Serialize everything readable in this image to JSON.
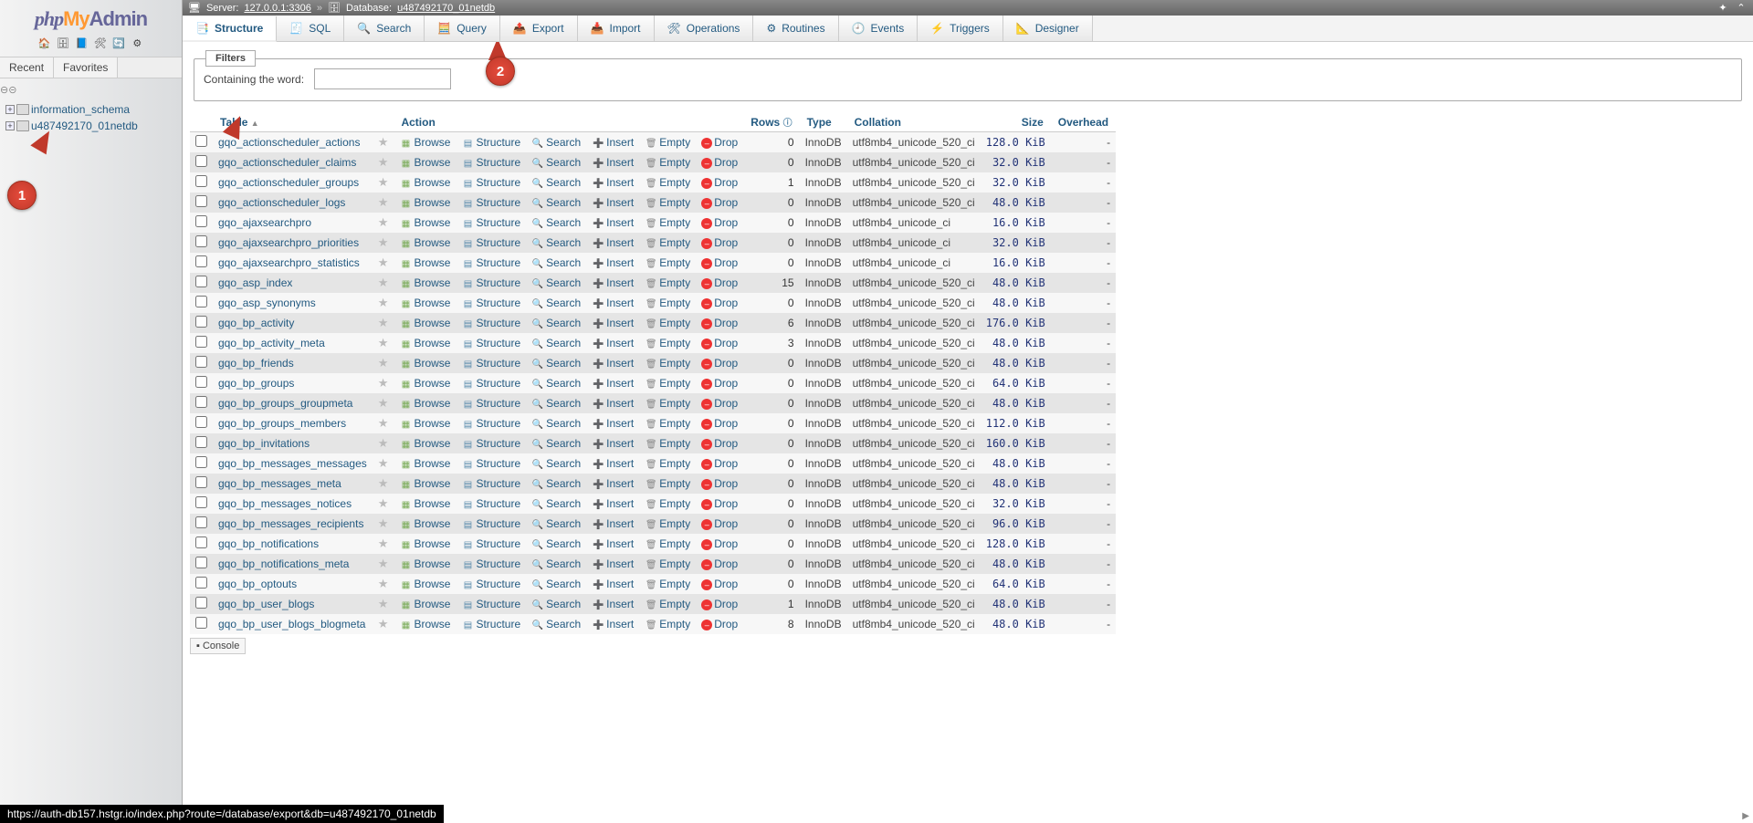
{
  "logo": {
    "p1": "php",
    "p2": "My",
    "p3": "Admin"
  },
  "side_icons": [
    "🏠",
    "🗄",
    "📘",
    "🛠",
    "🔄",
    "⚙"
  ],
  "tree_tabs": {
    "recent": "Recent",
    "favorites": "Favorites"
  },
  "tree_databases": [
    "information_schema",
    "u487492170_01netdb"
  ],
  "breadcrumb": {
    "server_label": "Server:",
    "server": "127.0.0.1:3306",
    "database_label": "Database:",
    "database": "u487492170_01netdb"
  },
  "tabs": [
    {
      "label": "Structure",
      "icon": "📑",
      "active": true
    },
    {
      "label": "SQL",
      "icon": "🧾",
      "active": false
    },
    {
      "label": "Search",
      "icon": "🔍",
      "active": false
    },
    {
      "label": "Query",
      "icon": "🧮",
      "active": false
    },
    {
      "label": "Export",
      "icon": "📤",
      "active": false
    },
    {
      "label": "Import",
      "icon": "📥",
      "active": false
    },
    {
      "label": "Operations",
      "icon": "🛠",
      "active": false
    },
    {
      "label": "Routines",
      "icon": "⚙",
      "active": false
    },
    {
      "label": "Events",
      "icon": "🕘",
      "active": false
    },
    {
      "label": "Triggers",
      "icon": "⚡",
      "active": false
    },
    {
      "label": "Designer",
      "icon": "📐",
      "active": false
    }
  ],
  "filters": {
    "legend": "Filters",
    "label": "Containing the word:",
    "value": ""
  },
  "columns": {
    "table": "Table",
    "action": "Action",
    "rows": "Rows",
    "type": "Type",
    "collation": "Collation",
    "size": "Size",
    "overhead": "Overhead"
  },
  "actions": {
    "browse": "Browse",
    "structure": "Structure",
    "search": "Search",
    "insert": "Insert",
    "empty": "Empty",
    "drop": "Drop"
  },
  "tables": [
    {
      "name": "gqo_actionscheduler_actions",
      "rows": 0,
      "type": "InnoDB",
      "collation": "utf8mb4_unicode_520_ci",
      "size": "128.0 KiB",
      "overhead": "-"
    },
    {
      "name": "gqo_actionscheduler_claims",
      "rows": 0,
      "type": "InnoDB",
      "collation": "utf8mb4_unicode_520_ci",
      "size": "32.0 KiB",
      "overhead": "-"
    },
    {
      "name": "gqo_actionscheduler_groups",
      "rows": 1,
      "type": "InnoDB",
      "collation": "utf8mb4_unicode_520_ci",
      "size": "32.0 KiB",
      "overhead": "-"
    },
    {
      "name": "gqo_actionscheduler_logs",
      "rows": 0,
      "type": "InnoDB",
      "collation": "utf8mb4_unicode_520_ci",
      "size": "48.0 KiB",
      "overhead": "-"
    },
    {
      "name": "gqo_ajaxsearchpro",
      "rows": 0,
      "type": "InnoDB",
      "collation": "utf8mb4_unicode_ci",
      "size": "16.0 KiB",
      "overhead": "-"
    },
    {
      "name": "gqo_ajaxsearchpro_priorities",
      "rows": 0,
      "type": "InnoDB",
      "collation": "utf8mb4_unicode_ci",
      "size": "32.0 KiB",
      "overhead": "-"
    },
    {
      "name": "gqo_ajaxsearchpro_statistics",
      "rows": 0,
      "type": "InnoDB",
      "collation": "utf8mb4_unicode_ci",
      "size": "16.0 KiB",
      "overhead": "-"
    },
    {
      "name": "gqo_asp_index",
      "rows": 15,
      "type": "InnoDB",
      "collation": "utf8mb4_unicode_520_ci",
      "size": "48.0 KiB",
      "overhead": "-"
    },
    {
      "name": "gqo_asp_synonyms",
      "rows": 0,
      "type": "InnoDB",
      "collation": "utf8mb4_unicode_520_ci",
      "size": "48.0 KiB",
      "overhead": "-"
    },
    {
      "name": "gqo_bp_activity",
      "rows": 6,
      "type": "InnoDB",
      "collation": "utf8mb4_unicode_520_ci",
      "size": "176.0 KiB",
      "overhead": "-"
    },
    {
      "name": "gqo_bp_activity_meta",
      "rows": 3,
      "type": "InnoDB",
      "collation": "utf8mb4_unicode_520_ci",
      "size": "48.0 KiB",
      "overhead": "-"
    },
    {
      "name": "gqo_bp_friends",
      "rows": 0,
      "type": "InnoDB",
      "collation": "utf8mb4_unicode_520_ci",
      "size": "48.0 KiB",
      "overhead": "-"
    },
    {
      "name": "gqo_bp_groups",
      "rows": 0,
      "type": "InnoDB",
      "collation": "utf8mb4_unicode_520_ci",
      "size": "64.0 KiB",
      "overhead": "-"
    },
    {
      "name": "gqo_bp_groups_groupmeta",
      "rows": 0,
      "type": "InnoDB",
      "collation": "utf8mb4_unicode_520_ci",
      "size": "48.0 KiB",
      "overhead": "-"
    },
    {
      "name": "gqo_bp_groups_members",
      "rows": 0,
      "type": "InnoDB",
      "collation": "utf8mb4_unicode_520_ci",
      "size": "112.0 KiB",
      "overhead": "-"
    },
    {
      "name": "gqo_bp_invitations",
      "rows": 0,
      "type": "InnoDB",
      "collation": "utf8mb4_unicode_520_ci",
      "size": "160.0 KiB",
      "overhead": "-"
    },
    {
      "name": "gqo_bp_messages_messages",
      "rows": 0,
      "type": "InnoDB",
      "collation": "utf8mb4_unicode_520_ci",
      "size": "48.0 KiB",
      "overhead": "-"
    },
    {
      "name": "gqo_bp_messages_meta",
      "rows": 0,
      "type": "InnoDB",
      "collation": "utf8mb4_unicode_520_ci",
      "size": "48.0 KiB",
      "overhead": "-"
    },
    {
      "name": "gqo_bp_messages_notices",
      "rows": 0,
      "type": "InnoDB",
      "collation": "utf8mb4_unicode_520_ci",
      "size": "32.0 KiB",
      "overhead": "-"
    },
    {
      "name": "gqo_bp_messages_recipients",
      "rows": 0,
      "type": "InnoDB",
      "collation": "utf8mb4_unicode_520_ci",
      "size": "96.0 KiB",
      "overhead": "-"
    },
    {
      "name": "gqo_bp_notifications",
      "rows": 0,
      "type": "InnoDB",
      "collation": "utf8mb4_unicode_520_ci",
      "size": "128.0 KiB",
      "overhead": "-"
    },
    {
      "name": "gqo_bp_notifications_meta",
      "rows": 0,
      "type": "InnoDB",
      "collation": "utf8mb4_unicode_520_ci",
      "size": "48.0 KiB",
      "overhead": "-"
    },
    {
      "name": "gqo_bp_optouts",
      "rows": 0,
      "type": "InnoDB",
      "collation": "utf8mb4_unicode_520_ci",
      "size": "64.0 KiB",
      "overhead": "-"
    },
    {
      "name": "gqo_bp_user_blogs",
      "rows": 1,
      "type": "InnoDB",
      "collation": "utf8mb4_unicode_520_ci",
      "size": "48.0 KiB",
      "overhead": "-"
    },
    {
      "name": "gqo_bp_user_blogs_blogmeta",
      "rows": 8,
      "type": "InnoDB",
      "collation": "utf8mb4_unicode_520_ci",
      "size": "48.0 KiB",
      "overhead": "-"
    }
  ],
  "console": "Console",
  "status_url": "https://auth-db157.hstgr.io/index.php?route=/database/export&db=u487492170_01netdb",
  "markers": {
    "m1": "1",
    "m2": "2"
  }
}
